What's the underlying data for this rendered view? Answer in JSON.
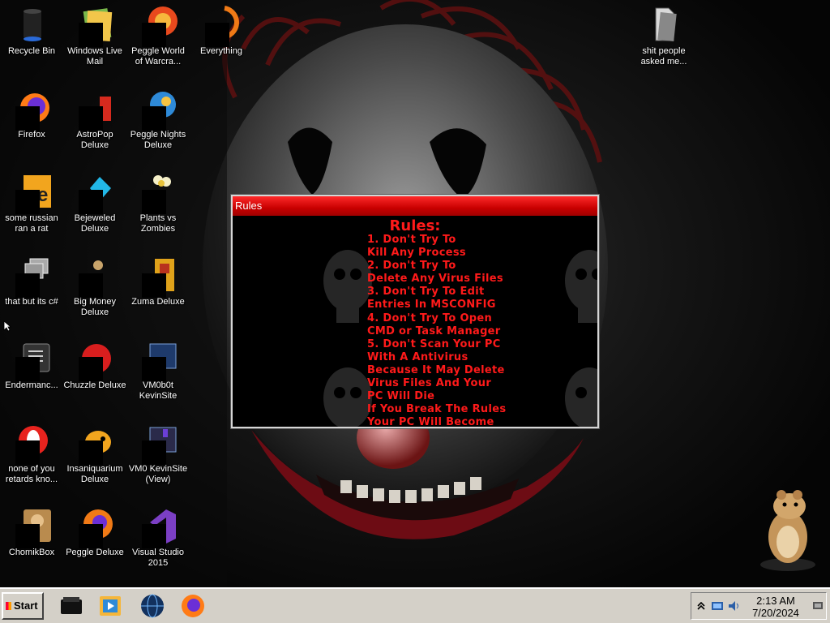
{
  "desktop_icons": [
    {
      "label": "Recycle Bin",
      "icon": "recycle-bin-icon"
    },
    {
      "label": "Windows Live Mail",
      "icon": "mail-icon"
    },
    {
      "label": "Peggle World of Warcra...",
      "icon": "peggle-icon"
    },
    {
      "label": "Everything",
      "icon": "search-app-icon"
    },
    {
      "label": "shit people asked me...",
      "icon": "folder-icon"
    },
    {
      "label": "Firefox",
      "icon": "firefox-icon"
    },
    {
      "label": "AstroPop Deluxe",
      "icon": "astropop-icon"
    },
    {
      "label": "Peggle Nights Deluxe",
      "icon": "peggle-nights-icon"
    },
    {
      "label": "some russian ran a rat",
      "icon": "exe-icon"
    },
    {
      "label": "Bejeweled Deluxe",
      "icon": "bejeweled-icon"
    },
    {
      "label": "Plants vs Zombies",
      "icon": "plants-vs-zombies-icon"
    },
    {
      "label": "that but its c#",
      "icon": "window-stack-icon"
    },
    {
      "label": "Big Money Deluxe",
      "icon": "money-bag-icon"
    },
    {
      "label": "Zuma Deluxe",
      "icon": "zuma-icon"
    },
    {
      "label": "Endermanc...",
      "icon": "terminal-icon"
    },
    {
      "label": "Chuzzle Deluxe",
      "icon": "chuzzle-icon"
    },
    {
      "label": "VM0b0t KevinSite",
      "icon": "website-icon"
    },
    {
      "label": "none of you retards kno...",
      "icon": "opera-icon"
    },
    {
      "label": "Insaniquarium Deluxe",
      "icon": "fish-icon"
    },
    {
      "label": "VM0 KevinSite (View)",
      "icon": "website-view-icon"
    },
    {
      "label": "ChomikBox",
      "icon": "hamster-box-icon"
    },
    {
      "label": "Peggle Deluxe",
      "icon": "peggle-deluxe-icon"
    },
    {
      "label": "Visual Studio 2015",
      "icon": "visual-studio-icon"
    }
  ],
  "rules_window": {
    "title": "Rules",
    "heading": "Rules:",
    "lines": [
      "1. Don't Try To",
      "Kill Any Process",
      "2. Don't Try To",
      "Delete Any Virus Files",
      "3. Don't Try To Edit",
      "Entries In MSCONFIG",
      "4. Don't Try To Open",
      "CMD or Task Manager",
      "5. Don't Scan Your PC",
      "With A Antivirus",
      "Because It May Delete",
      "Virus Files And Your",
      "PC Will Die",
      "If You Break The Rules",
      "Your PC Will Become"
    ],
    "text_color": "#ff1a1a",
    "titlebar_color": "#d10000"
  },
  "taskbar": {
    "start_label": "Start",
    "quick_launch": [
      "media-player-icon",
      "video-icon",
      "globe-icon",
      "firefox-icon"
    ],
    "tray_icons": [
      "chevron-up-icon",
      "network-icon",
      "volume-icon",
      "show-desktop-icon"
    ],
    "time": "2:13 AM",
    "date": "7/20/2024"
  }
}
